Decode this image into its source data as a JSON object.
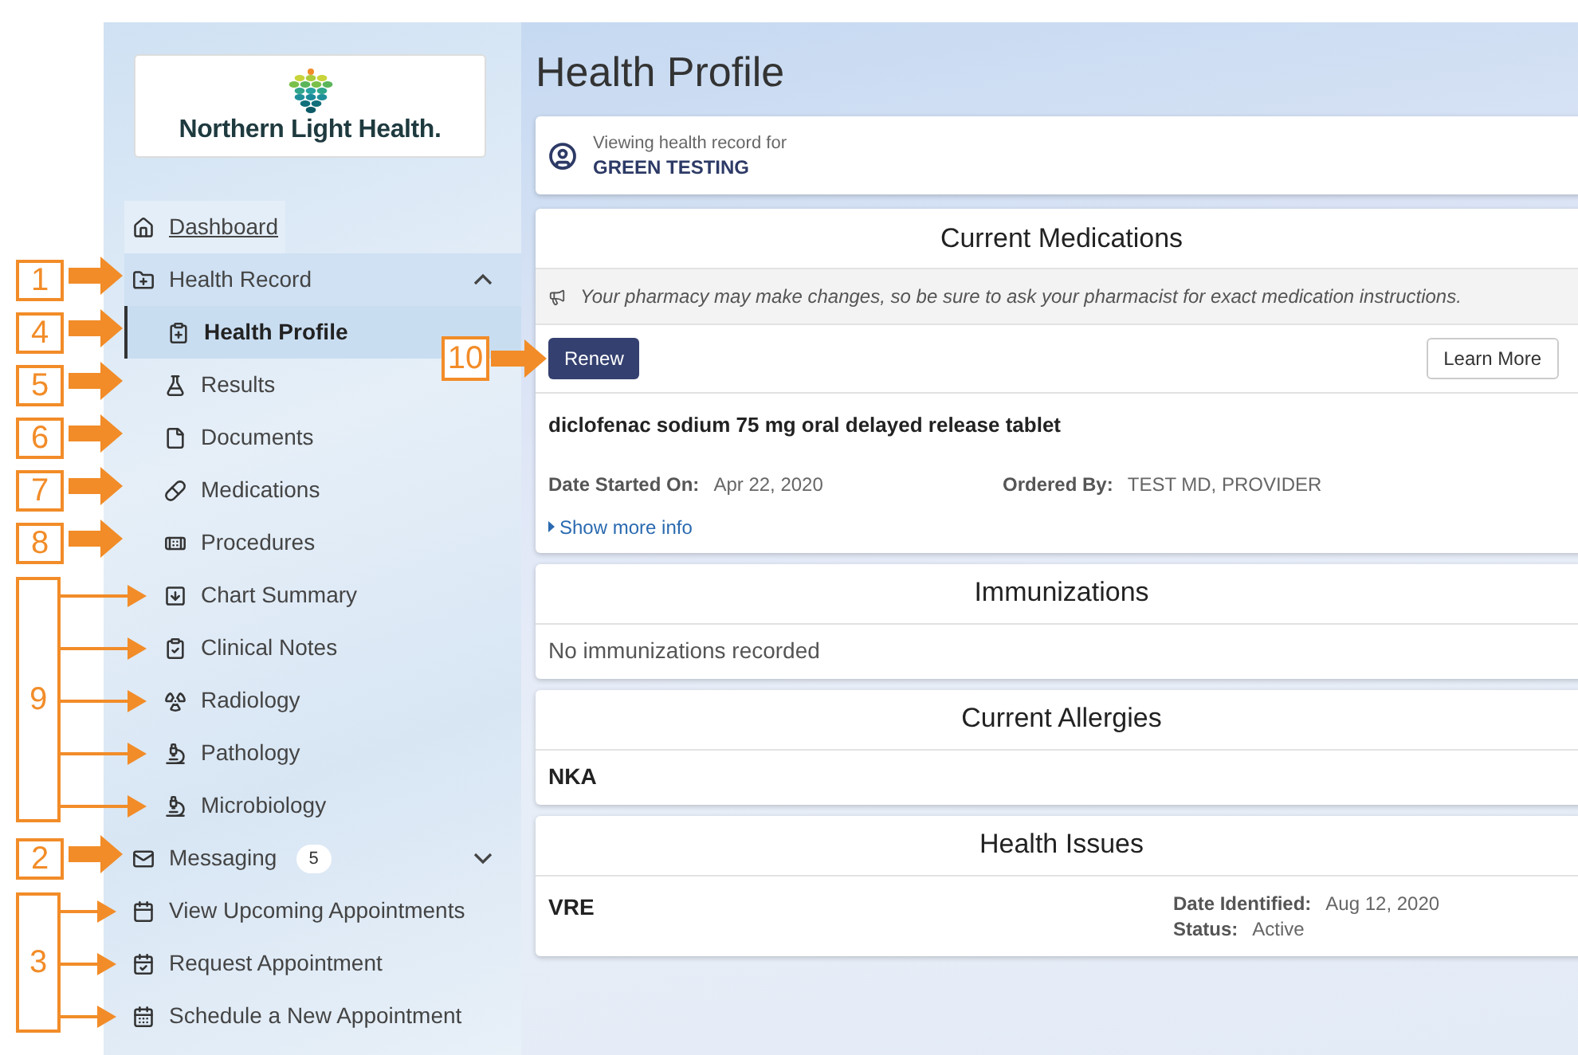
{
  "logo": {
    "text": "Northern Light Health."
  },
  "nav": [
    {
      "label": "Dashboard",
      "kind": "link",
      "selected": false
    },
    {
      "label": "Health Record",
      "kind": "section",
      "expanded": true,
      "selected": false,
      "callout": "1",
      "children": [
        {
          "label": "Health Profile",
          "kind": "item",
          "selected": true,
          "callout": "4"
        },
        {
          "label": "Results",
          "kind": "item",
          "selected": false,
          "callout": "5"
        },
        {
          "label": "Documents",
          "kind": "item",
          "selected": false,
          "callout": "6"
        },
        {
          "label": "Medications",
          "kind": "item",
          "selected": false,
          "callout": "7"
        },
        {
          "label": "Procedures",
          "kind": "item",
          "selected": false,
          "callout": "8"
        },
        {
          "label": "Chart Summary",
          "kind": "item",
          "selected": false,
          "callout": "9"
        },
        {
          "label": "Clinical Notes",
          "kind": "item",
          "selected": false,
          "callout_continued": true
        },
        {
          "label": "Radiology",
          "kind": "item",
          "selected": false,
          "callout_continued": true
        },
        {
          "label": "Pathology",
          "kind": "item",
          "selected": false,
          "callout_continued": true
        },
        {
          "label": "Microbiology",
          "kind": "item",
          "selected": false,
          "callout_continued": true
        }
      ]
    },
    {
      "label": "Messaging",
      "kind": "section",
      "expanded": false,
      "selected": false,
      "badge": "5",
      "callout": "2"
    },
    {
      "label": "View Upcoming Appointments",
      "kind": "item",
      "selected": false,
      "callout": "3"
    },
    {
      "label": "Request Appointment",
      "kind": "item",
      "selected": false,
      "callout_continued": true
    },
    {
      "label": "Schedule a New Appointment",
      "kind": "item",
      "selected": false,
      "callout_continued": true
    }
  ],
  "page_title": "Health Profile",
  "patient": {
    "caption": "Viewing health record for",
    "name": "GREEN TESTING"
  },
  "medications": {
    "title": "Current Medications",
    "notice": "Your pharmacy may make changes, so be sure to ask your pharmacist for exact medication instructions.",
    "actions": [
      {
        "label": "Renew",
        "kind": "primary",
        "callout": "10"
      },
      {
        "label": "Learn More",
        "kind": "secondary"
      }
    ],
    "items": [
      {
        "name": "diclofenac sodium 75 mg oral delayed release tablet",
        "fields": [
          {
            "label": "Date Started On:",
            "value": "Apr 22, 2020"
          },
          {
            "label": "Ordered By:",
            "value": "TEST MD, PROVIDER"
          }
        ],
        "more_link": "Show more info"
      }
    ]
  },
  "immunizations": {
    "title": "Immunizations",
    "empty_text": "No immunizations recorded"
  },
  "allergies": {
    "title": "Current Allergies",
    "items": [
      "NKA"
    ]
  },
  "health_issues": {
    "title": "Health Issues",
    "items": [
      {
        "name": "VRE",
        "fields": [
          {
            "label": "Date Identified:",
            "value": "Aug 12, 2020"
          },
          {
            "label": "Status:",
            "value": "Active"
          }
        ]
      }
    ]
  }
}
